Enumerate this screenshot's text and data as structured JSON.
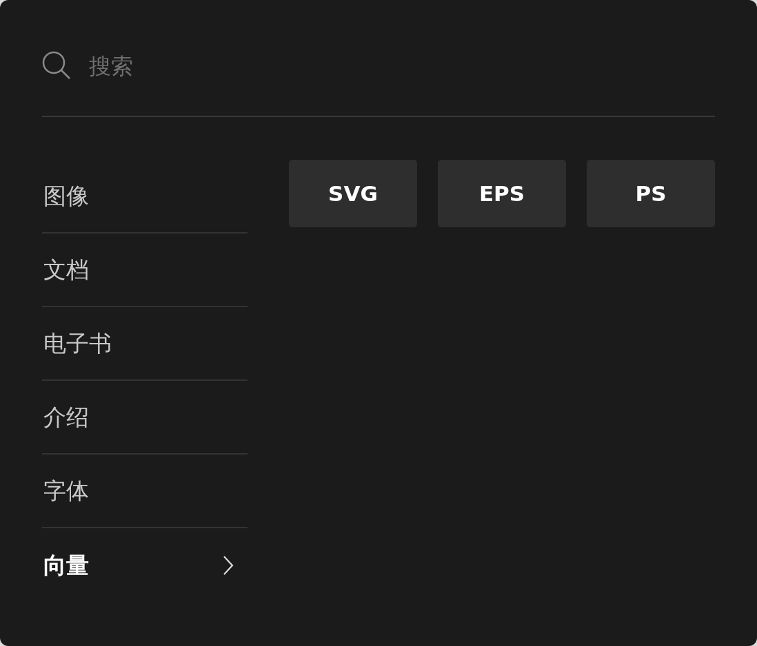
{
  "search": {
    "placeholder": "搜索"
  },
  "categories": [
    {
      "label": "图像",
      "selected": false
    },
    {
      "label": "文档",
      "selected": false
    },
    {
      "label": "电子书",
      "selected": false
    },
    {
      "label": "介绍",
      "selected": false
    },
    {
      "label": "字体",
      "selected": false
    },
    {
      "label": "向量",
      "selected": true
    }
  ],
  "formats": [
    "SVG",
    "EPS",
    "PS"
  ]
}
